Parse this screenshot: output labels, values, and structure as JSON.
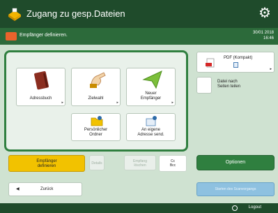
{
  "header": {
    "title": "Zugang zu gesp.Dateien",
    "settings_icon": "gear-icon"
  },
  "status": {
    "message": "Empfänger definieren.",
    "date": "30/01 2018",
    "time": "16:46"
  },
  "tiles": {
    "adressbuch": "Adressbuch",
    "zielwahl": "Zielwahl",
    "neuer_empfaenger_line1": "Neuer",
    "neuer_empfaenger_line2": "Empfänger",
    "persoenlicher_ordner_line1": "Persönlicher",
    "persoenlicher_ordner_line2": "Ordner",
    "eigene_adresse_line1": "An eigene",
    "eigene_adresse_line2": "Adresse send."
  },
  "right_panel": {
    "pdf_line1": "PDF (Kompakt)",
    "pdf_icon": "pdf-icon",
    "divide_line1": "Datei nach",
    "divide_line2": "Seiten teilen"
  },
  "actions": {
    "define_line1": "Empfänger",
    "define_line2": "definieren",
    "details": "Details",
    "delete_line1": "Empfang",
    "delete_line2": "löschen",
    "cc_line1": "Cc",
    "cc_line2": "Bcc",
    "options": "Optionen",
    "back": "Zurück",
    "scan_start": "Starten des Scanvorgangs"
  },
  "footer": {
    "logout": "Logout"
  },
  "colors": {
    "titlebar": "#1f4b2b",
    "accent_green": "#2f7f3f",
    "panel_bg": "#cfe2d1",
    "selected_yellow": "#f2c200",
    "scan_blue": "#8ec1e0"
  }
}
